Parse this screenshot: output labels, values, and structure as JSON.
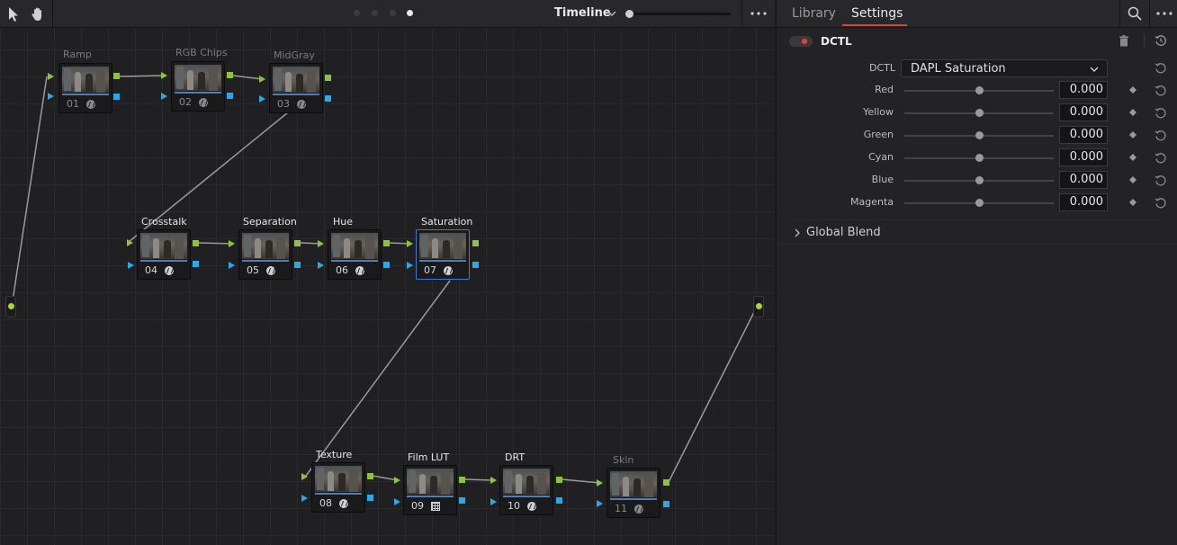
{
  "toolbar": {
    "title": "Timeline",
    "page_dots": 4,
    "active_dot": 4
  },
  "nodes": [
    {
      "id": "01",
      "label": "Ramp",
      "icon": "fx-icon",
      "dim": true,
      "selected": false
    },
    {
      "id": "02",
      "label": "RGB Chips",
      "icon": "fx-icon",
      "dim": true,
      "selected": false
    },
    {
      "id": "03",
      "label": "MidGray",
      "icon": "fx-icon",
      "dim": true,
      "selected": false
    },
    {
      "id": "04",
      "label": "Crosstalk",
      "icon": "fx-icon",
      "dim": false,
      "selected": false
    },
    {
      "id": "05",
      "label": "Separation",
      "icon": "fx-icon",
      "dim": false,
      "selected": false
    },
    {
      "id": "06",
      "label": "Hue",
      "icon": "fx-icon",
      "dim": false,
      "selected": false
    },
    {
      "id": "07",
      "label": "Saturation",
      "icon": "fx-icon",
      "dim": false,
      "selected": true
    },
    {
      "id": "08",
      "label": "Texture",
      "icon": "fx-icon",
      "dim": false,
      "selected": false
    },
    {
      "id": "09",
      "label": "Film LUT",
      "icon": "lut-grid-icon",
      "dim": false,
      "selected": false
    },
    {
      "id": "10",
      "label": "DRT",
      "icon": "fx-icon",
      "dim": false,
      "selected": false
    },
    {
      "id": "11",
      "label": "Skin",
      "icon": "fx-icon",
      "dim": true,
      "selected": false
    }
  ],
  "panel": {
    "tabs": [
      {
        "label": "Library",
        "active": false
      },
      {
        "label": "Settings",
        "active": true
      }
    ],
    "effect_name": "DCTL",
    "effect_enabled": true,
    "dctl_field_label": "DCTL",
    "dctl_selected": "DAPL Saturation",
    "params": [
      {
        "label": "Red",
        "value": "0.000",
        "position": 0.5
      },
      {
        "label": "Yellow",
        "value": "0.000",
        "position": 0.5
      },
      {
        "label": "Green",
        "value": "0.000",
        "position": 0.5
      },
      {
        "label": "Cyan",
        "value": "0.000",
        "position": 0.5
      },
      {
        "label": "Blue",
        "value": "0.000",
        "position": 0.5
      },
      {
        "label": "Magenta",
        "value": "0.000",
        "position": 0.5
      }
    ],
    "global_blend_label": "Global Blend"
  },
  "colors": {
    "rgb_port": "#8cc43c",
    "alpha_port": "#2ba9e6",
    "selected_border": "#3d7ad6",
    "active_tab_underline": "#d0453b",
    "toggle_on": "#e6423a"
  }
}
